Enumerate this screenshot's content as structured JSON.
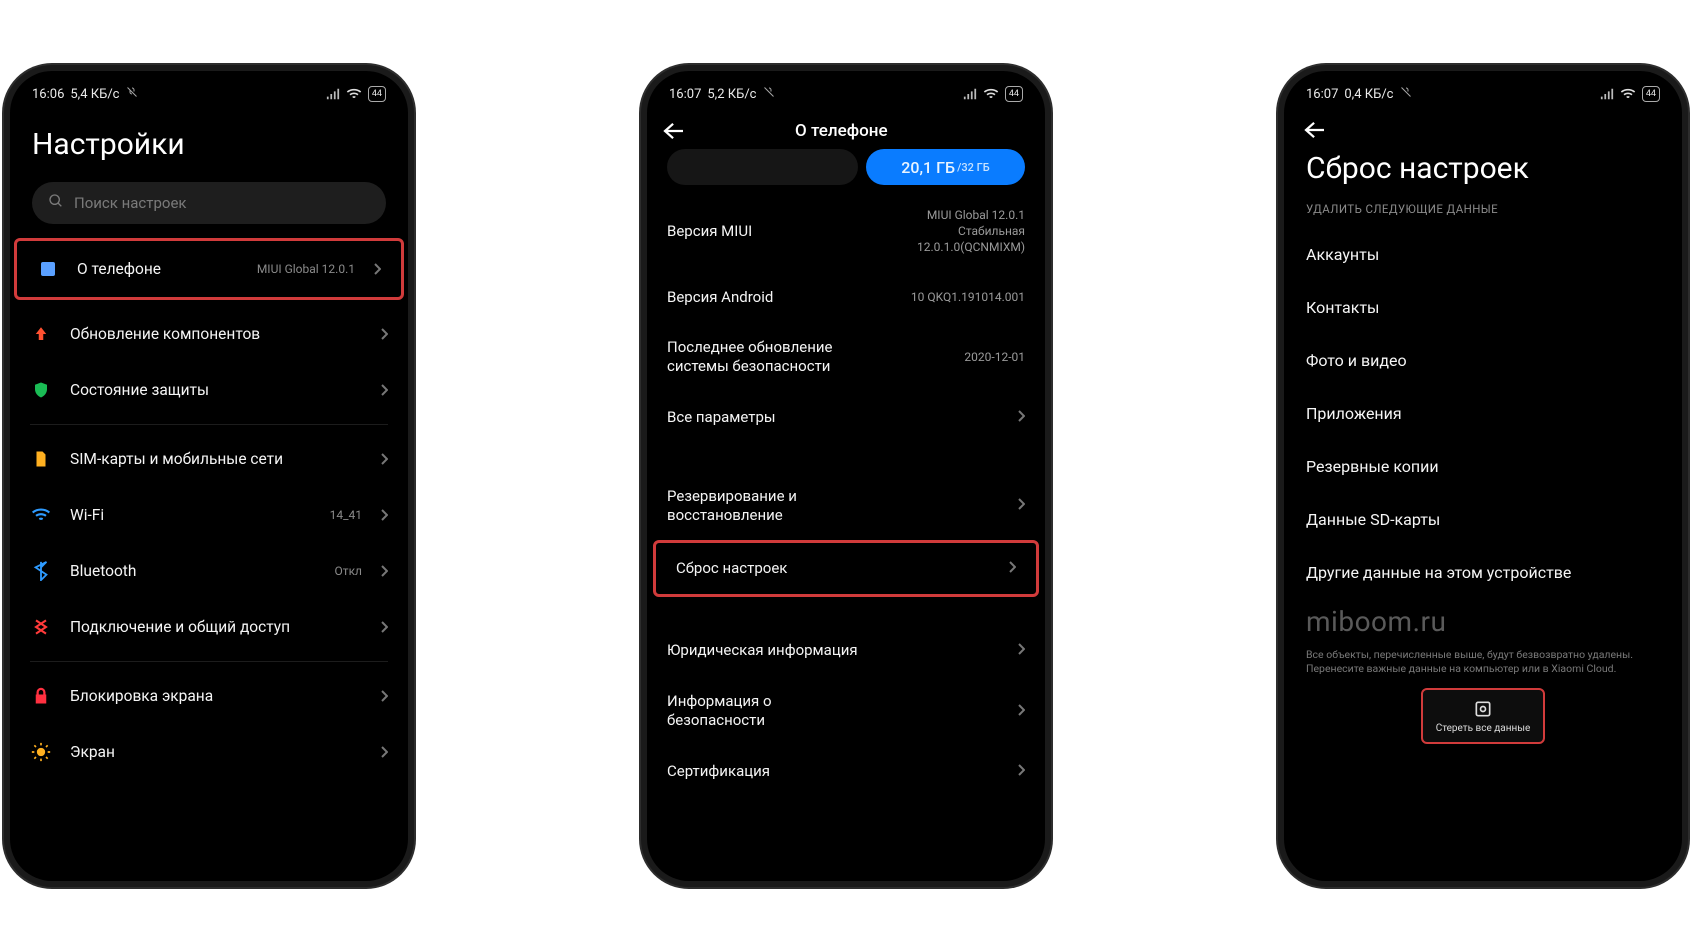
{
  "status": {
    "phone1_time": "16:06",
    "phone1_net": "5,4 КБ/с",
    "phone2_time": "16:07",
    "phone2_net": "5,2 КБ/с",
    "phone3_time": "16:07",
    "phone3_net": "0,4 КБ/с",
    "battery": "44"
  },
  "phone1": {
    "title": "Настройки",
    "search_placeholder": "Поиск настроек",
    "rows": {
      "about": {
        "label": "О телефоне",
        "value": "MIUI Global 12.0.1"
      },
      "updates": {
        "label": "Обновление компонентов"
      },
      "security": {
        "label": "Состояние защиты"
      },
      "sim": {
        "label": "SIM-карты и мобильные сети"
      },
      "wifi": {
        "label": "Wi-Fi",
        "value": "14_41"
      },
      "bluetooth": {
        "label": "Bluetooth",
        "value": "Откл"
      },
      "share": {
        "label": "Подключение и общий доступ"
      },
      "lock": {
        "label": "Блокировка экрана"
      },
      "display": {
        "label": "Экран"
      }
    }
  },
  "phone2": {
    "title": "О телефоне",
    "storage_used": "20,1 ГБ",
    "storage_total": "/32 ГБ",
    "miui_label": "Версия MIUI",
    "miui_value_l1": "MIUI Global 12.0.1",
    "miui_value_l2": "Стабильная",
    "miui_value_l3": "12.0.1.0(QCNMIXM)",
    "android_label": "Версия Android",
    "android_value": "10 QKQ1.191014.001",
    "patch_label": "Последнее обновление системы безопасности",
    "patch_value": "2020-12-01",
    "allspecs_label": "Все параметры",
    "backup_label": "Резервирование и восстановление",
    "reset_label": "Сброс настроек",
    "legal_label": "Юридическая информация",
    "safety_label": "Информация о безопасности",
    "cert_label": "Сертификация"
  },
  "phone3": {
    "title": "Сброс настроек",
    "section": "УДАЛИТЬ СЛЕДУЮЩИЕ ДАННЫЕ",
    "items": {
      "accounts": "Аккаунты",
      "contacts": "Контакты",
      "media": "Фото и видео",
      "apps": "Приложения",
      "backups": "Резервные копии",
      "sd": "Данные SD-карты",
      "other": "Другие данные на этом устройстве"
    },
    "watermark": "miboom.ru",
    "footnote": "Все объекты, перечисленные выше, будут безвозвратно удалены. Перенесите важные данные на компьютер или в Xiaomi Cloud.",
    "erase_label": "Стереть все данные"
  }
}
